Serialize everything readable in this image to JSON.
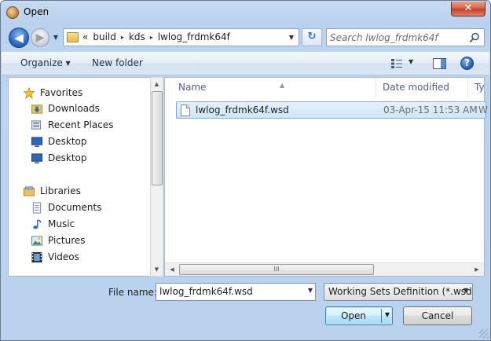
{
  "window": {
    "title": "Open",
    "close_symbol": "✕"
  },
  "nav": {
    "back_symbol": "◀",
    "forward_symbol": "▶",
    "history_symbol": "▼",
    "refresh_symbol": "↻"
  },
  "address": {
    "overflow_symbol": "«",
    "crumbs": [
      "build",
      "kds",
      "lwlog_frdmk64f"
    ],
    "separator": "▸",
    "dropdown_symbol": "▼"
  },
  "search": {
    "placeholder": "Search lwlog_frdmk64f"
  },
  "toolbar": {
    "organize_label": "Organize ▾",
    "new_folder_label": "New folder",
    "views_dropdown": "▼",
    "help_symbol": "?"
  },
  "sidebar": {
    "favorites": {
      "label": "Favorites",
      "items": [
        "Downloads",
        "Recent Places",
        "Desktop",
        "Desktop"
      ]
    },
    "libraries": {
      "label": "Libraries",
      "items": [
        "Documents",
        "Music",
        "Pictures",
        "Videos"
      ]
    }
  },
  "columns": {
    "name": "Name",
    "date_modified": "Date modified",
    "type": "Ty"
  },
  "files": [
    {
      "name": "lwlog_frdmk64f.wsd",
      "date": "03-Apr-15 11:53 AM",
      "type": "W",
      "selected": true
    }
  ],
  "scroll": {
    "up": "▲",
    "down": "▼",
    "left": "◀",
    "right": "▶",
    "grip": "III"
  },
  "bottom": {
    "file_name_label": "File name:",
    "file_name_value": "lwlog_frdmk64f.wsd",
    "filter_value": "Working Sets Definition (*.wsd)",
    "dropdown_symbol": "▼",
    "open_label": "Open",
    "cancel_label": "Cancel"
  },
  "colors": {
    "accent": "#2d6bc2",
    "selection": "#cfe5fb",
    "selection_border": "#84acdd",
    "close": "#c33f24"
  }
}
